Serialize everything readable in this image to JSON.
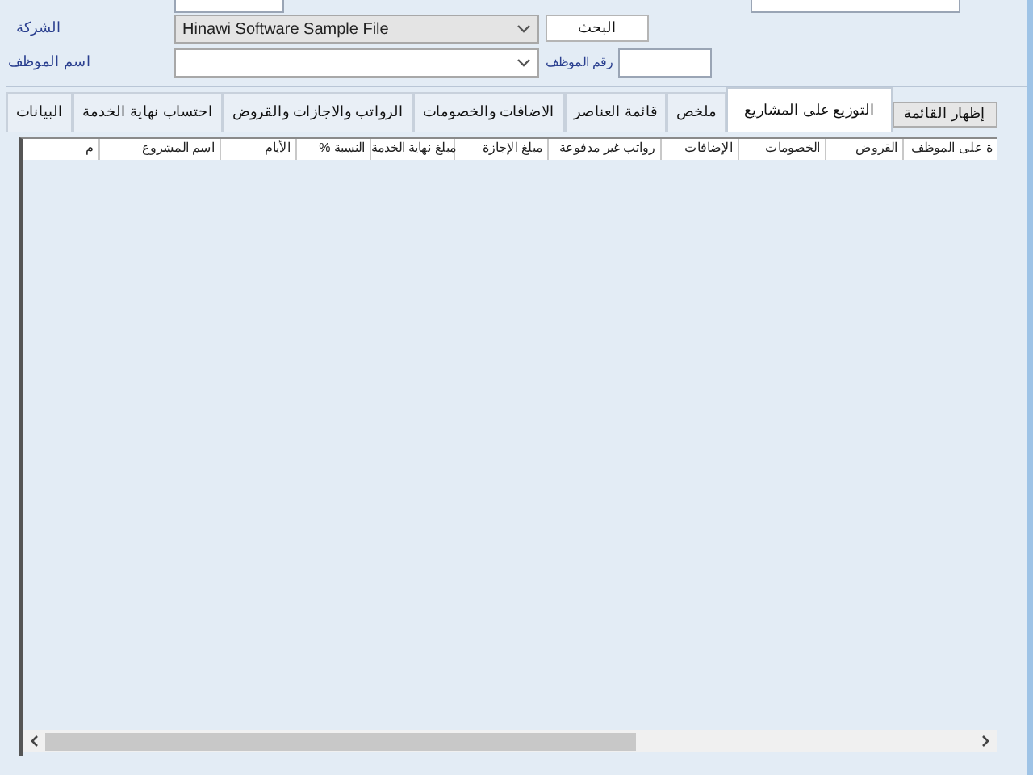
{
  "form": {
    "company_label": "الشركة",
    "company_value": "Hinawi Software Sample File",
    "search_button": "البحث",
    "employee_name_label": "اسم الموظف",
    "employee_number_label": "رقم الموظف"
  },
  "tabs": [
    {
      "label": "التوزيع على المشاريع",
      "selected": true
    },
    {
      "label": "ملخص",
      "selected": false
    },
    {
      "label": "قائمة العناصر",
      "selected": false
    },
    {
      "label": "الاضافات والخصومات",
      "selected": false
    },
    {
      "label": "الرواتب والاجازات والقروض",
      "selected": false
    },
    {
      "label": "احتساب نهاية الخدمة",
      "selected": false
    },
    {
      "label": "البيانات",
      "selected": false
    }
  ],
  "show_list_button": "إظهار القائمة",
  "table": {
    "columns": [
      "ة على الموظف",
      "القروض",
      "الخصومات",
      "الإضافات",
      "رواتب غير مدفوعة",
      "مبلغ الإجازة",
      "مبلغ نهاية الخدمة",
      "% النسبة",
      "الأيام",
      "اسم المشروع",
      "م"
    ]
  }
}
